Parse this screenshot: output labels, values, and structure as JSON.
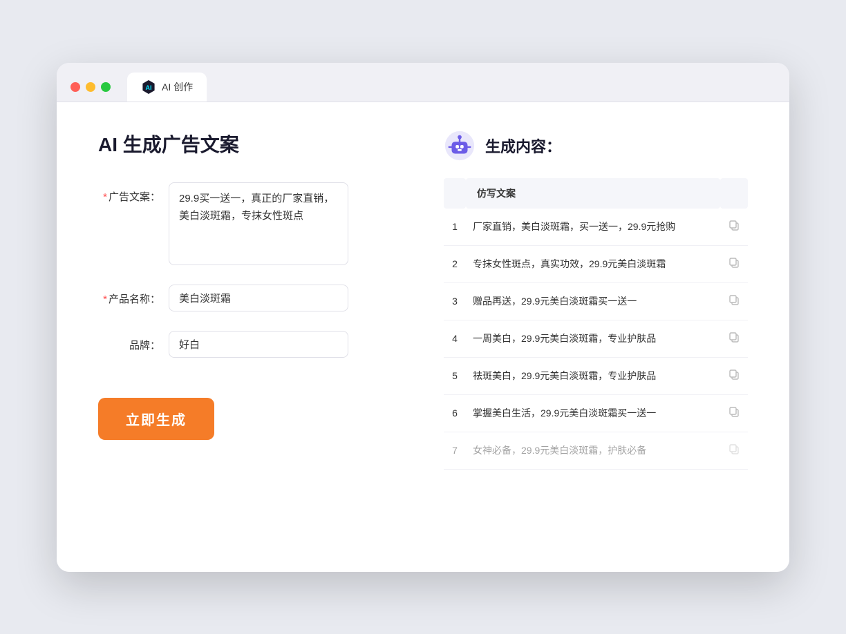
{
  "browser": {
    "tab_label": "AI 创作"
  },
  "left": {
    "title": "AI 生成广告文案",
    "ad_label": "广告文案：",
    "ad_required": "*",
    "ad_value": "29.9买一送一，真正的厂家直销，美白淡斑霜，专抹女性斑点",
    "product_label": "产品名称：",
    "product_required": "*",
    "product_value": "美白淡斑霜",
    "brand_label": "品牌：",
    "brand_value": "好白",
    "btn_label": "立即生成"
  },
  "right": {
    "title": "生成内容：",
    "table_header": "仿写文案",
    "results": [
      {
        "num": 1,
        "text": "厂家直销，美白淡斑霜，买一送一，29.9元抢购"
      },
      {
        "num": 2,
        "text": "专抹女性斑点，真实功效，29.9元美白淡斑霜"
      },
      {
        "num": 3,
        "text": "赠品再送，29.9元美白淡斑霜买一送一"
      },
      {
        "num": 4,
        "text": "一周美白，29.9元美白淡斑霜，专业护肤品"
      },
      {
        "num": 5,
        "text": "祛斑美白，29.9元美白淡斑霜，专业护肤品"
      },
      {
        "num": 6,
        "text": "掌握美白生活，29.9元美白淡斑霜买一送一"
      },
      {
        "num": 7,
        "text": "女神必备，29.9元美白淡斑霜，护肤必备"
      }
    ]
  }
}
